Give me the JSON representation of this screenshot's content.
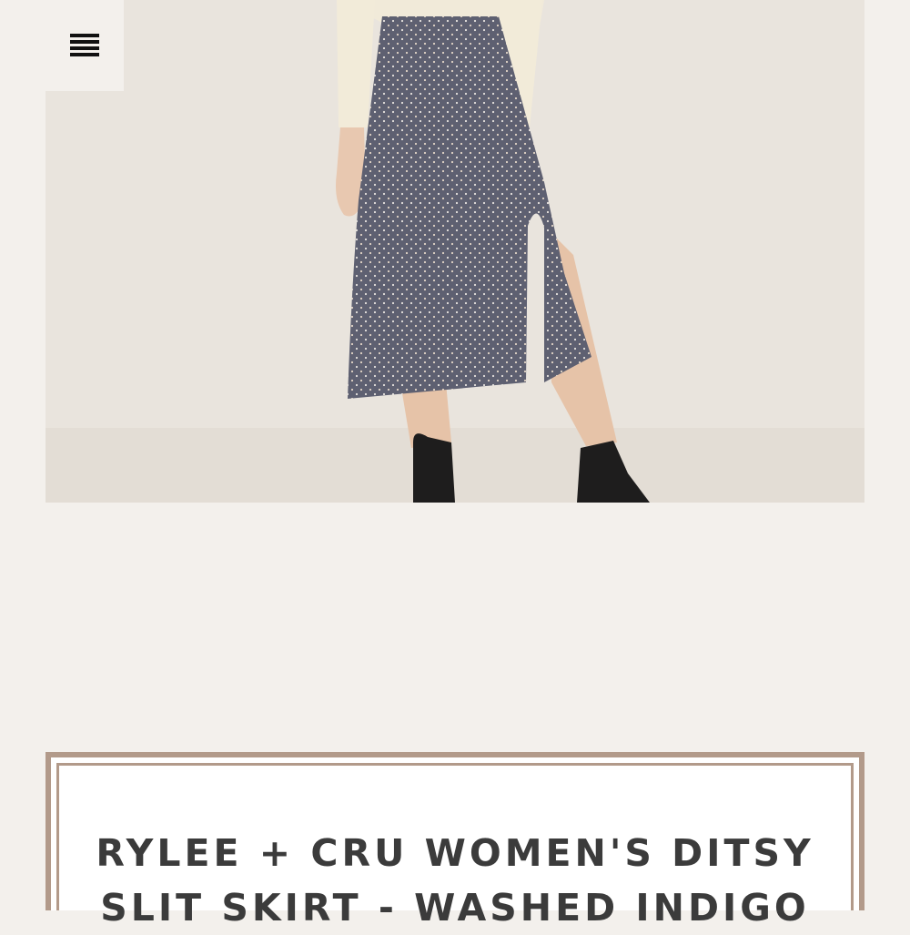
{
  "header": {
    "menu_icon": "hamburger-menu-icon"
  },
  "hero": {
    "image_subject": "model wearing printed midi slit skirt with ankle boots"
  },
  "product": {
    "title_line1": "RYLEE + CRU WOMEN'S DITSY",
    "title_line2": "SLIT SKIRT - WASHED INDIGO"
  },
  "colors": {
    "page_background": "#f3f0ec",
    "photo_background": "#e8e3dc",
    "card_border": "#b29a8a",
    "title_text": "#3b3b3b"
  }
}
